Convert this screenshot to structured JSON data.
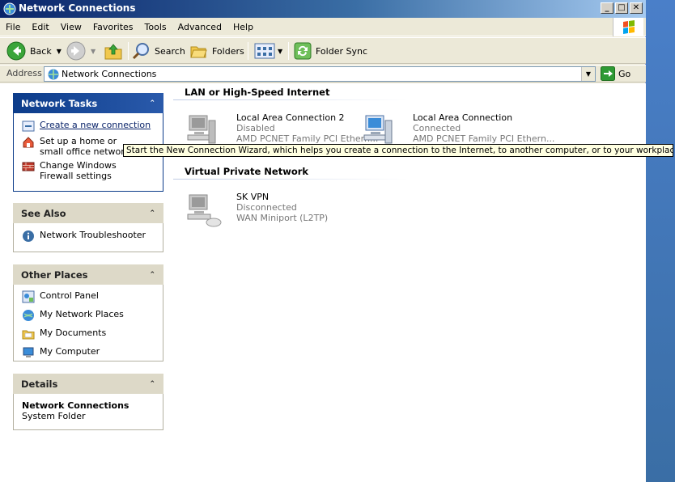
{
  "window": {
    "title": "Network Connections",
    "controls": {
      "minimize": "_",
      "maximize": "□",
      "close": "✕"
    }
  },
  "menubar": {
    "items": [
      "File",
      "Edit",
      "View",
      "Favorites",
      "Tools",
      "Advanced",
      "Help"
    ]
  },
  "toolbar": {
    "back_label": "Back",
    "search_label": "Search",
    "folders_label": "Folders",
    "folder_sync_label": "Folder Sync"
  },
  "address": {
    "label": "Address",
    "value": "Network Connections",
    "go_label": "Go"
  },
  "task_panes": {
    "network_tasks": {
      "title": "Network Tasks",
      "items": [
        {
          "label": "Create a new connection",
          "icon": "new-connection-icon"
        },
        {
          "label": "Set up a home or small office network",
          "icon": "home-network-icon"
        },
        {
          "label": "Change Windows Firewall settings",
          "icon": "firewall-icon"
        }
      ]
    },
    "see_also": {
      "title": "See Also",
      "items": [
        {
          "label": "Network Troubleshooter",
          "icon": "info-icon"
        }
      ]
    },
    "other_places": {
      "title": "Other Places",
      "items": [
        {
          "label": "Control Panel",
          "icon": "control-panel-icon"
        },
        {
          "label": "My Network Places",
          "icon": "network-places-icon"
        },
        {
          "label": "My Documents",
          "icon": "documents-folder-icon"
        },
        {
          "label": "My Computer",
          "icon": "computer-icon"
        }
      ]
    },
    "details": {
      "title": "Details",
      "name": "Network Connections",
      "type": "System Folder"
    }
  },
  "groups": {
    "lan": {
      "title": "LAN or High-Speed Internet",
      "connections": [
        {
          "name": "Local Area Connection 2",
          "status": "Disabled",
          "device": "AMD PCNET Family PCI Ethern..."
        },
        {
          "name": "Local Area Connection",
          "status": "Connected",
          "device": "AMD PCNET Family PCI Ethern..."
        }
      ]
    },
    "vpn": {
      "title": "Virtual Private Network",
      "connections": [
        {
          "name": "SK VPN",
          "status": "Disconnected",
          "device": "WAN Miniport (L2TP)"
        }
      ]
    }
  },
  "tooltip": {
    "text": "Start the New Connection Wizard, which helps you create a connection to the Internet, to another computer, or to your workplace network."
  },
  "colors": {
    "title_bar": "#0a246a",
    "task_header": "#0c3c8a",
    "window_bg": "#ece9d8",
    "tooltip_bg": "#ffffe1",
    "go_green": "#2e9a34"
  }
}
